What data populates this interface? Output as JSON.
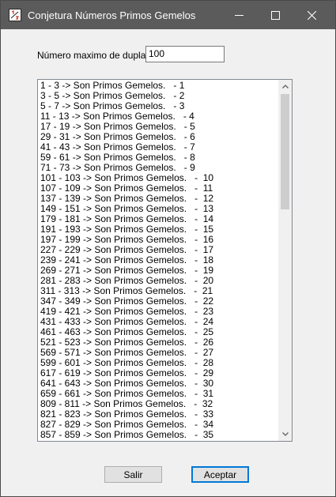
{
  "window": {
    "title": "Conjetura Números Primos Gemelos",
    "icon": "fraction-app-icon",
    "controls": [
      "minimize-icon",
      "maximize-icon",
      "close-icon"
    ]
  },
  "form": {
    "max_label": "Número maximo de duplas:",
    "max_value": "100"
  },
  "list": {
    "items": [
      "1 - 3 -> Son Primos Gemelos.   - 1",
      "3 - 5 -> Son Primos Gemelos.   - 2",
      "5 - 7 -> Son Primos Gemelos.   - 3",
      "11 - 13 -> Son Primos Gemelos.   - 4",
      "17 - 19 -> Son Primos Gemelos.   - 5",
      "29 - 31 -> Son Primos Gemelos.   - 6",
      "41 - 43 -> Son Primos Gemelos.   - 7",
      "59 - 61 -> Son Primos Gemelos.   - 8",
      "71 - 73 -> Son Primos Gemelos.   - 9",
      "101 - 103 -> Son Primos Gemelos.   -  10",
      "107 - 109 -> Son Primos Gemelos.   -  11",
      "137 - 139 -> Son Primos Gemelos.   -  12",
      "149 - 151 -> Son Primos Gemelos.   -  13",
      "179 - 181 -> Son Primos Gemelos.   -  14",
      "191 - 193 -> Son Primos Gemelos.   -  15",
      "197 - 199 -> Son Primos Gemelos.   -  16",
      "227 - 229 -> Son Primos Gemelos.   -  17",
      "239 - 241 -> Son Primos Gemelos.   -  18",
      "269 - 271 -> Son Primos Gemelos.   -  19",
      "281 - 283 -> Son Primos Gemelos.   -  20",
      "311 - 313 -> Son Primos Gemelos.   -  21",
      "347 - 349 -> Son Primos Gemelos.   -  22",
      "419 - 421 -> Son Primos Gemelos.   -  23",
      "431 - 433 -> Son Primos Gemelos.   -  24",
      "461 - 463 -> Son Primos Gemelos.   -  25",
      "521 - 523 -> Son Primos Gemelos.   -  26",
      "569 - 571 -> Son Primos Gemelos.   -  27",
      "599 - 601 -> Son Primos Gemelos.   -  28",
      "617 - 619 -> Son Primos Gemelos.   -  29",
      "641 - 643 -> Son Primos Gemelos.   -  30",
      "659 - 661 -> Son Primos Gemelos.   -  31",
      "809 - 811 -> Son Primos Gemelos.   -  32",
      "821 - 823 -> Son Primos Gemelos.   -  33",
      "827 - 829 -> Son Primos Gemelos.   -  34",
      "857 - 859 -> Son Primos Gemelos.   -  35"
    ]
  },
  "buttons": {
    "exit_label": "Salir",
    "accept_label": "Aceptar"
  },
  "colors": {
    "titlebar": "#5b5b5b",
    "window_bg": "#f0f0f0",
    "accent": "#0078d7"
  }
}
